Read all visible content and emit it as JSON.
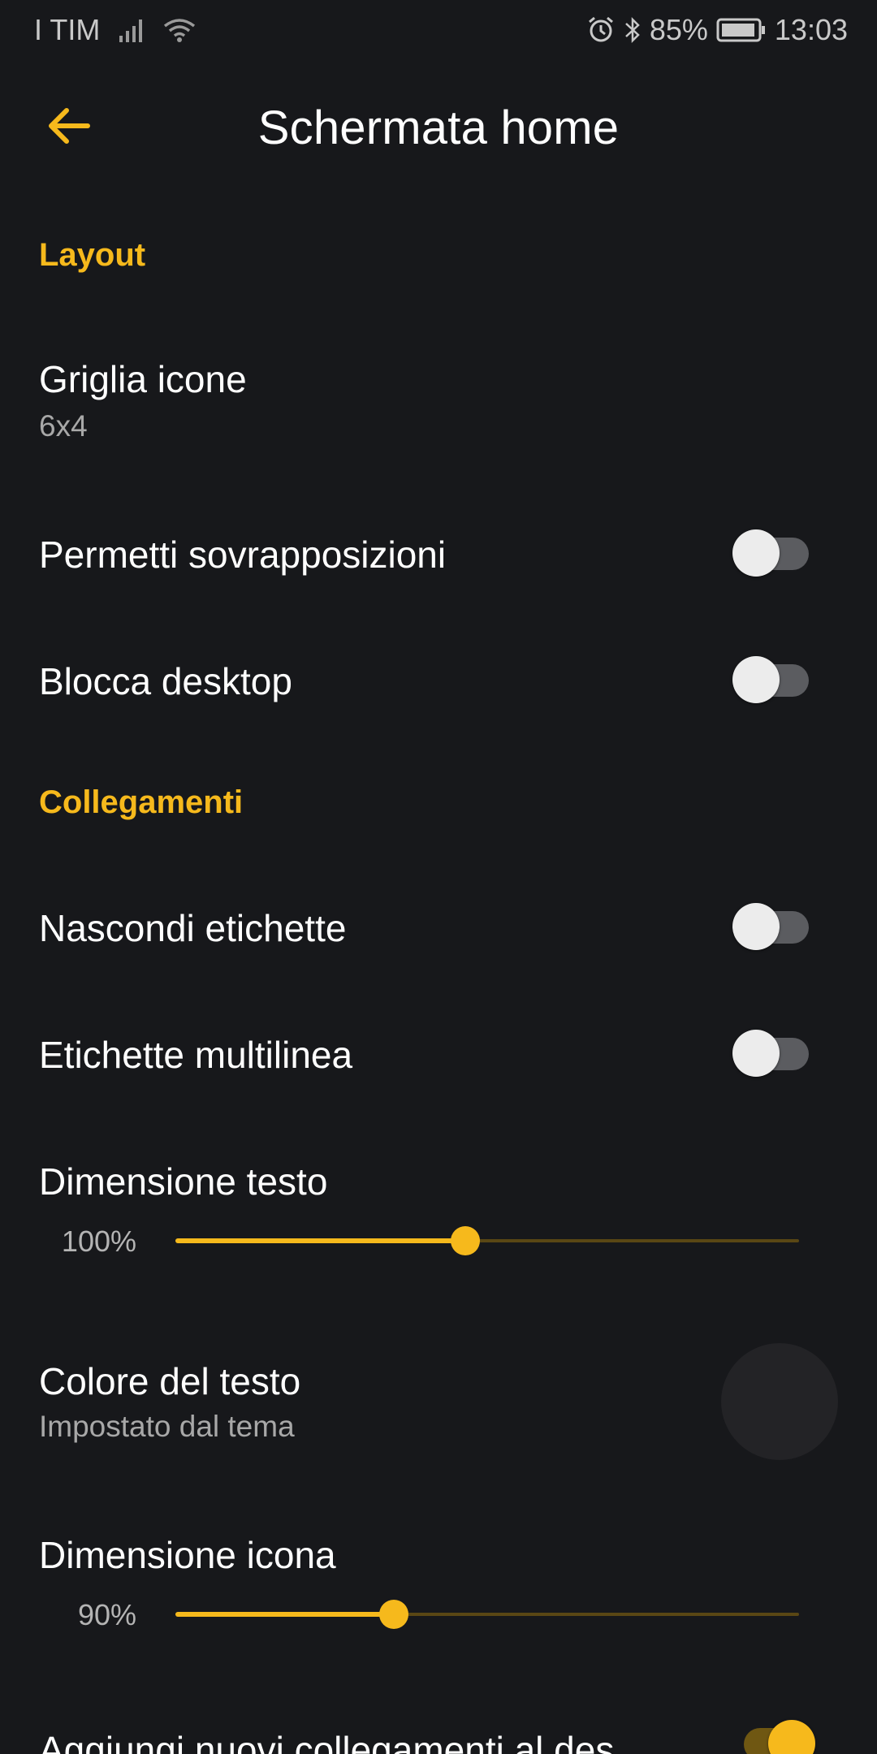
{
  "status_bar": {
    "carrier": "I TIM",
    "battery_percent": "85%",
    "time": "13:03"
  },
  "app_bar": {
    "title": "Schermata home"
  },
  "colors": {
    "accent": "#f6b91c",
    "background": "#17181b",
    "toggle_off_track": "#5b5c60",
    "toggle_off_thumb": "#ececec"
  },
  "sections": {
    "layout": {
      "header": "Layout",
      "icon_grid": {
        "title": "Griglia icone",
        "value": "6x4"
      },
      "allow_overlap": {
        "title": "Permetti sovrapposizioni",
        "enabled": false
      },
      "lock_desktop": {
        "title": "Blocca desktop",
        "enabled": false
      }
    },
    "shortcuts": {
      "header": "Collegamenti",
      "hide_labels": {
        "title": "Nascondi etichette",
        "enabled": false
      },
      "multiline_labels": {
        "title": "Etichette multilinea",
        "enabled": false
      },
      "text_size": {
        "title": "Dimensione testo",
        "value_label": "100%",
        "fraction": 0.465
      },
      "text_color": {
        "title": "Colore del testo",
        "subtitle": "Impostato dal tema"
      },
      "icon_size": {
        "title": "Dimensione icona",
        "value_label": "90%",
        "fraction": 0.35
      },
      "add_new_shortcuts": {
        "title": "Aggiungi nuovi collegamenti al des",
        "enabled": true
      }
    }
  },
  "icons": {
    "back": "arrow-left-icon",
    "signal": "cell-signal-icon",
    "wifi": "wifi-icon",
    "alarm": "alarm-clock-icon",
    "bluetooth": "bluetooth-icon",
    "battery": "battery-icon"
  }
}
